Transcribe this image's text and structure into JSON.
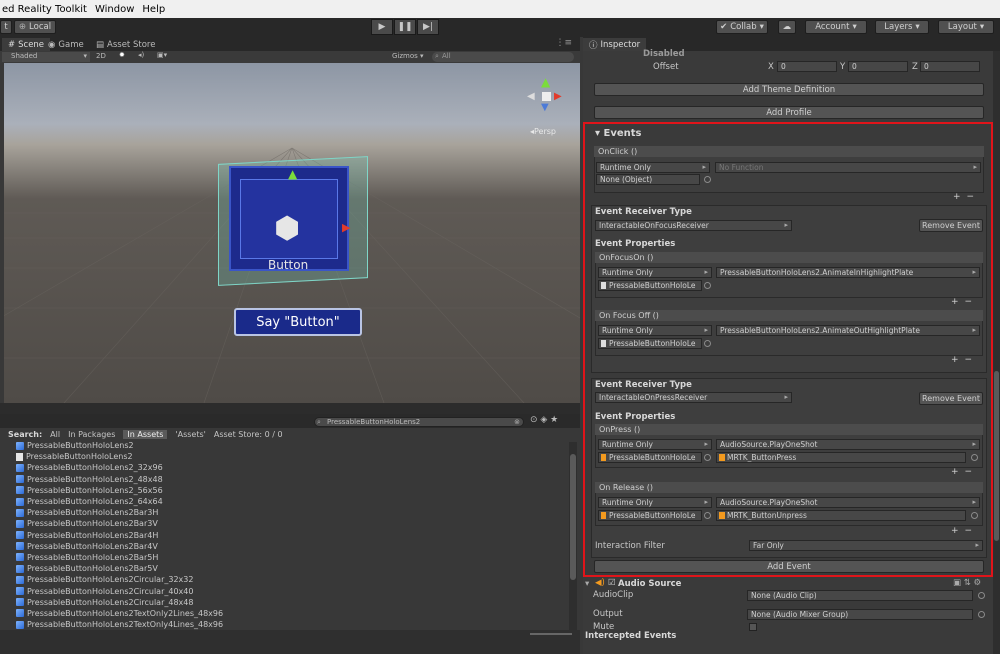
{
  "menu": {
    "items": [
      "ed Reality Toolkit",
      "Window",
      "Help"
    ]
  },
  "toolbar": {
    "left_label": "t",
    "local_label": "Local",
    "collab": "Collab",
    "account": "Account",
    "layers": "Layers",
    "layout": "Layout"
  },
  "scene": {
    "tabs": [
      "Scene",
      "Game",
      "Asset Store"
    ],
    "shading": "Shaded",
    "mode_2d": "2D",
    "gizmos": "Gizmos",
    "search": "All",
    "persp_label": "Persp",
    "button_label": "Button",
    "say_button": "Say \"Button\""
  },
  "project": {
    "search_value": "PressableButtonHoloLens2",
    "filters": {
      "search": "Search:",
      "all": "All",
      "in_packages": "In Packages",
      "in_assets": "In Assets",
      "assets": "'Assets'",
      "asset_store": "Asset Store: 0 / 0"
    },
    "items": [
      "PressableButtonHoloLens2",
      "PressableButtonHoloLens2",
      "PressableButtonHoloLens2_32x96",
      "PressableButtonHoloLens2_48x48",
      "PressableButtonHoloLens2_56x56",
      "PressableButtonHoloLens2_64x64",
      "PressableButtonHoloLens2Bar3H",
      "PressableButtonHoloLens2Bar3V",
      "PressableButtonHoloLens2Bar4H",
      "PressableButtonHoloLens2Bar4V",
      "PressableButtonHoloLens2Bar5H",
      "PressableButtonHoloLens2Bar5V",
      "PressableButtonHoloLens2Circular_32x32",
      "PressableButtonHoloLens2Circular_40x40",
      "PressableButtonHoloLens2Circular_48x48",
      "PressableButtonHoloLens2TextOnly2Lines_48x96",
      "PressableButtonHoloLens2TextOnly4Lines_48x96"
    ]
  },
  "inspector": {
    "tab": "Inspector",
    "disabled": "Disabled",
    "offset": "Offset",
    "x_label": "X",
    "x_value": "0",
    "y_label": "Y",
    "y_value": "0",
    "z_label": "Z",
    "z_value": "0",
    "add_theme": "Add Theme Definition",
    "add_profile": "Add Profile",
    "events_title": "Events",
    "onclick": {
      "header": "OnClick ()",
      "runtime": "Runtime Only",
      "function": "No Function",
      "object": "None (Object)"
    },
    "receiver1": {
      "type_label": "Event Receiver Type",
      "type_value": "InteractableOnFocusReceiver",
      "remove": "Remove Event",
      "props_label": "Event Properties",
      "event_a": {
        "header": "OnFocusOn ()",
        "runtime": "Runtime Only",
        "function": "PressableButtonHoloLens2.AnimateInHighlightPlate",
        "object": "PressableButtonHoloLe"
      },
      "event_b": {
        "header": "On Focus Off ()",
        "runtime": "Runtime Only",
        "function": "PressableButtonHoloLens2.AnimateOutHighlightPlate",
        "object": "PressableButtonHoloLe"
      }
    },
    "receiver2": {
      "type_label": "Event Receiver Type",
      "type_value": "InteractableOnPressReceiver",
      "remove": "Remove Event",
      "props_label": "Event Properties",
      "event_a": {
        "header": "OnPress ()",
        "runtime": "Runtime Only",
        "function": "AudioSource.PlayOneShot",
        "object": "PressableButtonHoloLe",
        "clip": "MRTK_ButtonPress"
      },
      "event_b": {
        "header": "On Release ()",
        "runtime": "Runtime Only",
        "function": "AudioSource.PlayOneShot",
        "object": "PressableButtonHoloLe",
        "clip": "MRTK_ButtonUnpress"
      },
      "filter_label": "Interaction Filter",
      "filter_value": "Far Only"
    },
    "add_event": "Add Event",
    "audio": {
      "title": "Audio Source",
      "clip_label": "AudioClip",
      "clip_value": "None (Audio Clip)",
      "output_label": "Output",
      "output_value": "None (Audio Mixer Group)",
      "mute_label": "Mute"
    },
    "intercepted": "Intercepted Events"
  },
  "colors": {
    "highlight_border": "#e0141a",
    "panel": "#383838",
    "button_blue": "#1d2a8c"
  }
}
